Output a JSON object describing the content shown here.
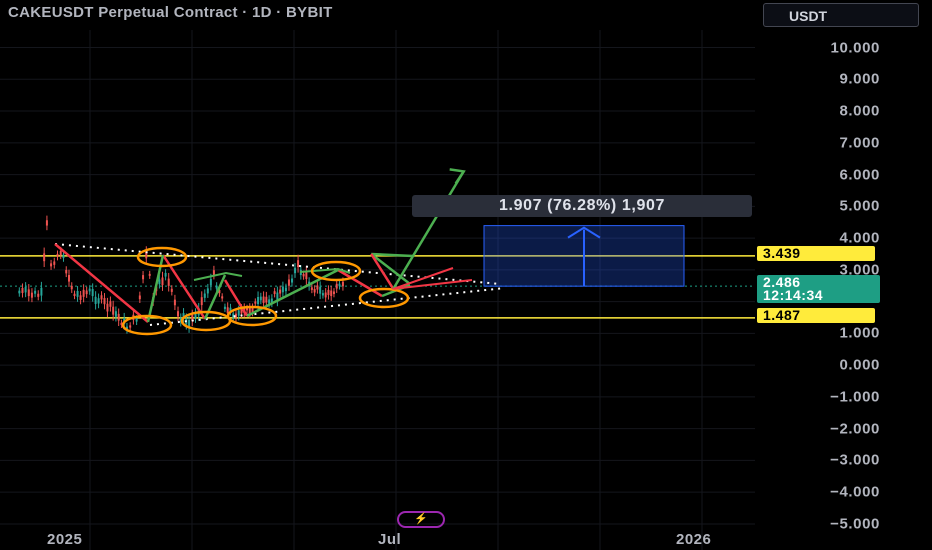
{
  "header": {
    "title": "CAKEUSDT Perpetual Contract · 1D · BYBIT",
    "currency": "USDT"
  },
  "badge": {
    "icon": "lightning-icon",
    "glyph": "⚡"
  },
  "chart_data": {
    "type": "line",
    "title": "CAKEUSDT Perpetual Contract · 1D · BYBIT",
    "xlabel": "",
    "ylabel": "",
    "ylim": [
      -5,
      10
    ],
    "y_ticks": [
      "10.000",
      "9.000",
      "8.000",
      "7.000",
      "6.000",
      "5.000",
      "4.000",
      "3.000",
      "",
      "",
      "1.000",
      "0.000",
      "−1.000",
      "−2.000",
      "−3.000",
      "−4.000",
      "−5.000"
    ],
    "y_tick_values": [
      10,
      9,
      8,
      7,
      6,
      5,
      4,
      3,
      2,
      1.5,
      1,
      0,
      -1,
      -2,
      -3,
      -4,
      -5
    ],
    "x_ticks": [
      "2025",
      "Jul",
      "2026"
    ],
    "grid": true,
    "colors": {
      "up": "#26a69a",
      "down": "#ef5350",
      "support": "#ffeb3b",
      "projection": "#4caf50",
      "pullback": "#f23645",
      "marker": "#ff9800",
      "measure": "#2962ff"
    },
    "price_series": {
      "name": "CAKEUSDT",
      "x": [
        "2024-11-15",
        "2024-12-01",
        "2024-12-05",
        "2024-12-08",
        "2024-12-15",
        "2024-12-25",
        "2025-01-05",
        "2025-01-20",
        "2025-02-01",
        "2025-02-08",
        "2025-02-15",
        "2025-02-20",
        "2025-03-01",
        "2025-03-10",
        "2025-03-18",
        "2025-03-25",
        "2025-04-05",
        "2025-04-15",
        "2025-04-25",
        "2025-05-05",
        "2025-05-15",
        "2025-05-25",
        "2025-06-05",
        "2025-06-15",
        "2025-06-25",
        "2025-07-05",
        "2025-07-10"
      ],
      "values": [
        2.3,
        2.2,
        4.4,
        3.2,
        3.6,
        2.2,
        2.3,
        1.8,
        1.2,
        1.5,
        3.4,
        2.1,
        2.9,
        1.6,
        1.3,
        1.8,
        2.8,
        1.7,
        1.6,
        1.9,
        2.1,
        2.3,
        3.1,
        2.5,
        2.2,
        2.4,
        2.5
      ]
    },
    "last_price": 2.486,
    "countdown": "12:14:34",
    "levels": [
      {
        "label": "3.439",
        "value": 3.439
      },
      {
        "label": "1.487",
        "value": 1.487
      }
    ],
    "measure": {
      "label": "1.907 (76.28%) 1,907",
      "from": 2.486,
      "to": 4.393
    },
    "projection_path": [
      [
        "2025-07-13",
        2.6
      ],
      [
        "2025-07-28",
        3.5
      ],
      [
        "2025-08-13",
        2.4
      ],
      [
        "2025-10-03",
        6.1
      ]
    ]
  }
}
